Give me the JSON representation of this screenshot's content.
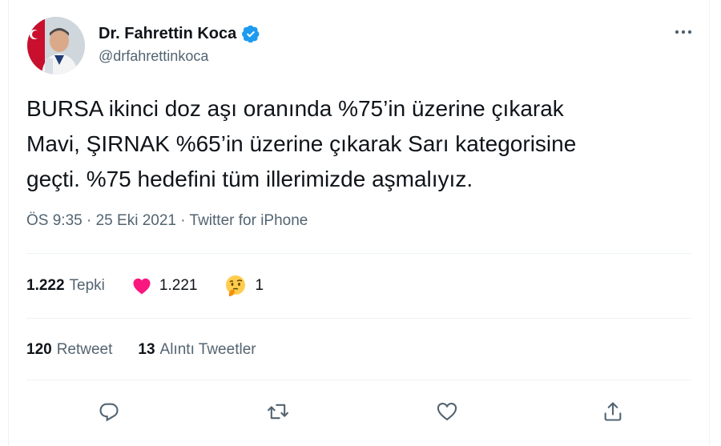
{
  "author": {
    "name": "Dr. Fahrettin Koca",
    "handle": "@drfahrettinkoca"
  },
  "tweet": {
    "text": "BURSA ikinci doz aşı oranında %75’in üzerine çıkarak\nMavi, ŞIRNAK %65’in üzerine çıkarak Sarı kategorisine\ngeçti. %75 hedefini tüm illerimizde aşmalıyız.",
    "time": "ÖS 9:35",
    "date": "25 Eki 2021",
    "source": "Twitter for iPhone",
    "separator": "·"
  },
  "reactions": {
    "total": "1.222",
    "total_label": "Tepki",
    "like_count": "1.221",
    "thinking_count": "1"
  },
  "retweets": {
    "count": "120",
    "label": "Retweet",
    "quote_count": "13",
    "quote_label": "Alıntı Tweetler"
  },
  "icons": {
    "verified": "verified-badge-icon",
    "more": "more-dots-icon",
    "heart": "heart-icon",
    "thinking": "thinking-face-icon",
    "reply": "reply-icon",
    "retweet": "retweet-icon",
    "like": "like-icon",
    "share": "share-icon"
  },
  "colors": {
    "verified": "#1d9bf0",
    "heart": "#f91880",
    "secondary_text": "#536471"
  }
}
